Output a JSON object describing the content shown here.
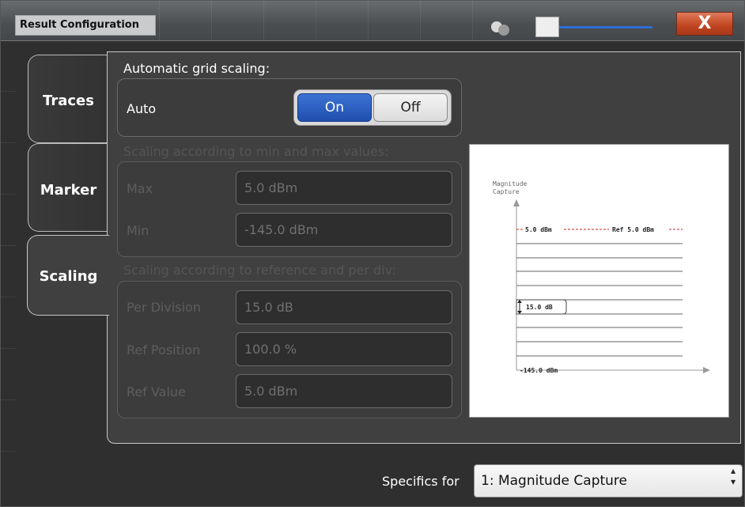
{
  "window": {
    "title": "Result Configuration",
    "close_label": "X"
  },
  "tabs": [
    {
      "label": "Traces"
    },
    {
      "label": "Marker"
    },
    {
      "label": "Scaling"
    }
  ],
  "auto_scaling": {
    "heading": "Automatic grid scaling:",
    "label": "Auto",
    "on_label": "On",
    "off_label": "Off",
    "selected": "On"
  },
  "minmax": {
    "heading": "Scaling according to min and max values:",
    "max_label": "Max",
    "max_value": "5.0 dBm",
    "min_label": "Min",
    "min_value": "-145.0 dBm"
  },
  "ref": {
    "heading": "Scaling according to reference and per div:",
    "per_div_label": "Per Division",
    "per_div_value": "15.0 dB",
    "ref_pos_label": "Ref Position",
    "ref_pos_value": "100.0 %",
    "ref_val_label": "Ref Value",
    "ref_val_value": "5.0 dBm"
  },
  "preview": {
    "axis_label_1": "Magnitude",
    "axis_label_2": "Capture",
    "top_value": "5.0 dBm",
    "ref_label": "Ref 5.0 dBm",
    "per_div": "15.0 dB",
    "bottom_value": "-145.0 dBm"
  },
  "specifics": {
    "label": "Specifics for",
    "selected": "1: Magnitude Capture"
  },
  "colors": {
    "accent": "#2d6fd6",
    "close": "#c0441f",
    "ref_line": "#cc2222"
  }
}
